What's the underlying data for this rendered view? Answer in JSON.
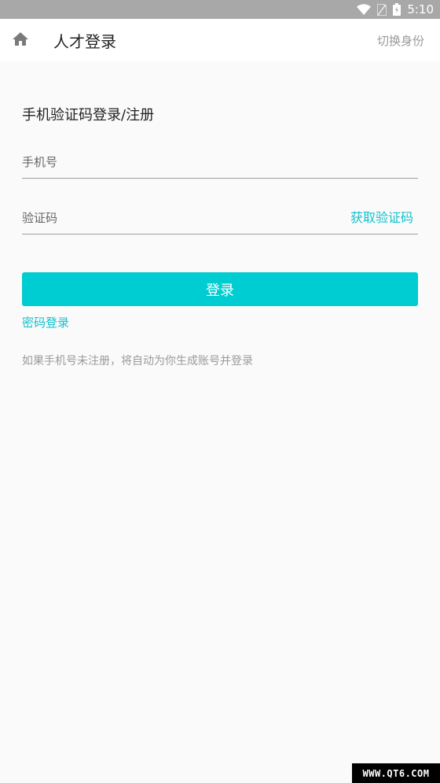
{
  "status_bar": {
    "time": "5:10",
    "icons": [
      "wifi-icon",
      "no-sim-icon",
      "battery-icon"
    ]
  },
  "app_bar": {
    "title": "人才登录",
    "switch_identity": "切换身份",
    "home_icon": "home-icon"
  },
  "login": {
    "section_title": "手机验证码登录/注册",
    "phone_placeholder": "手机号",
    "phone_value": "",
    "code_placeholder": "验证码",
    "code_value": "",
    "get_code_label": "获取验证码",
    "login_button": "登录",
    "password_login_link": "密码登录",
    "hint": "如果手机号未注册，将自动为你生成账号并登录"
  },
  "watermark": "WWW.QT6.COM",
  "colors": {
    "accent": "#00cdd1",
    "link": "#12c2cd",
    "status_bar": "#a8a8a8",
    "background": "#fafafa"
  }
}
